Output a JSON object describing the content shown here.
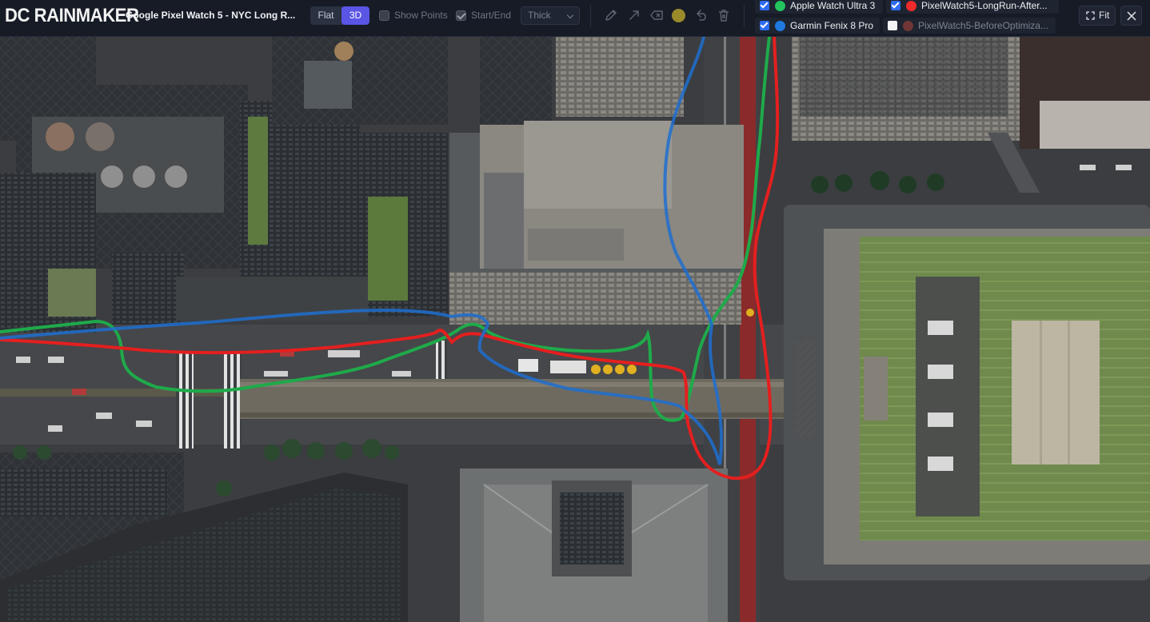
{
  "app": {
    "logo": "DC RAINMAKER",
    "title": "Google Pixel Watch 5 - NYC Long R..."
  },
  "toolbar": {
    "view_modes": [
      {
        "label": "Flat",
        "active": false
      },
      {
        "label": "3D",
        "active": true
      }
    ],
    "show_points": {
      "label": "Show Points",
      "checked": false
    },
    "start_end": {
      "label": "Start/End",
      "checked": true
    },
    "line_width": {
      "selected": "Thick"
    },
    "tools": [
      "pencil-icon",
      "arrow-icon",
      "eraser-icon",
      "color-swatch",
      "undo-icon",
      "trash-icon"
    ],
    "current_color": "#9a8a2a",
    "fit_label": "Fit"
  },
  "layers": [
    {
      "name": "Apple Watch Ultra 3",
      "color": "#22c55e",
      "visible": true
    },
    {
      "name": "PixelWatch5-LongRun-After...",
      "color": "#ef2b2b",
      "visible": true
    },
    {
      "name": "Garmin Fenix 8 Pro",
      "color": "#1f7ae0",
      "visible": true
    },
    {
      "name": "PixelWatch5-BeforeOptimiza...",
      "color": "#b4463a",
      "visible": false
    }
  ],
  "colors": {
    "accent": "#5b55e6",
    "checkbox_on": "#2d6cf0",
    "toolbar_bg": "#161b26"
  }
}
